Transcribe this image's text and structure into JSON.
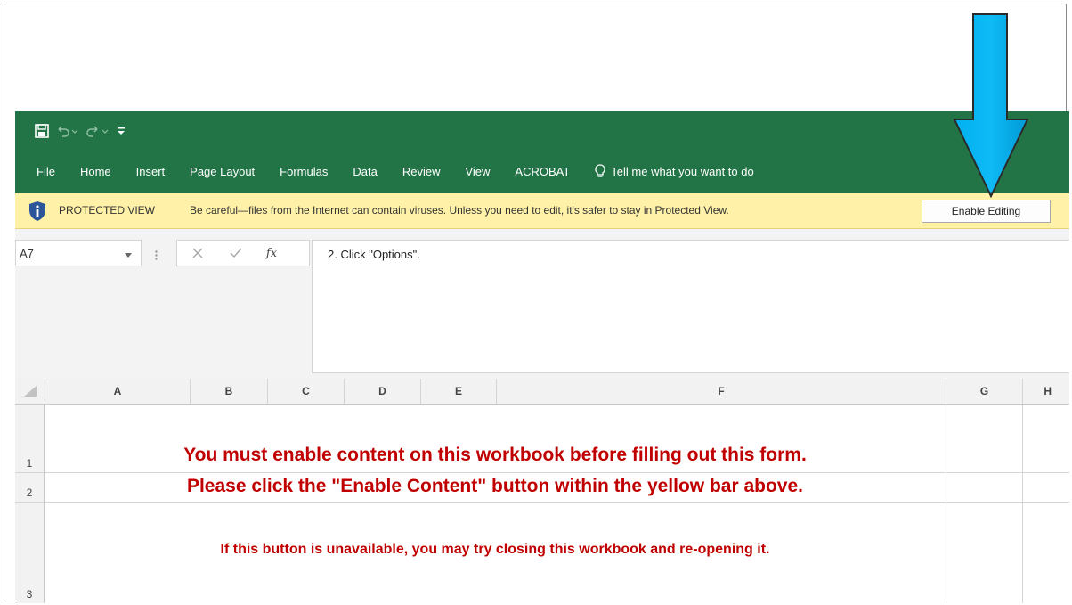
{
  "colors": {
    "ribbon_green": "#227447",
    "protected_yellow": "#fff2a8",
    "message_red": "#c00000",
    "arrow_blue": "#00b0f0"
  },
  "qat": {
    "icons": [
      "save-icon",
      "undo-icon",
      "redo-icon",
      "customize-qat-icon"
    ]
  },
  "ribbon": {
    "tabs": [
      "File",
      "Home",
      "Insert",
      "Page Layout",
      "Formulas",
      "Data",
      "Review",
      "View",
      "ACROBAT"
    ],
    "tell_me": "Tell me what you want to do"
  },
  "protected_view": {
    "title": "PROTECTED VIEW",
    "message": "Be careful—files from the Internet can contain viruses. Unless you need to edit, it's safer to stay in Protected View.",
    "button": "Enable Editing"
  },
  "formula_bar": {
    "name_box": "A7",
    "fx_symbol": "fx",
    "content": "2. Click \"Options\"."
  },
  "grid": {
    "columns": [
      "A",
      "B",
      "C",
      "D",
      "E",
      "F",
      "G",
      "H"
    ],
    "rows": [
      "1",
      "2",
      "3"
    ],
    "cells": {
      "row1": "You must enable content on this workbook before filling out this form.",
      "row2": "Please click the \"Enable Content\" button within the yellow bar above.",
      "row3": "If this button is unavailable, you may try closing this workbook and re-opening it."
    }
  }
}
